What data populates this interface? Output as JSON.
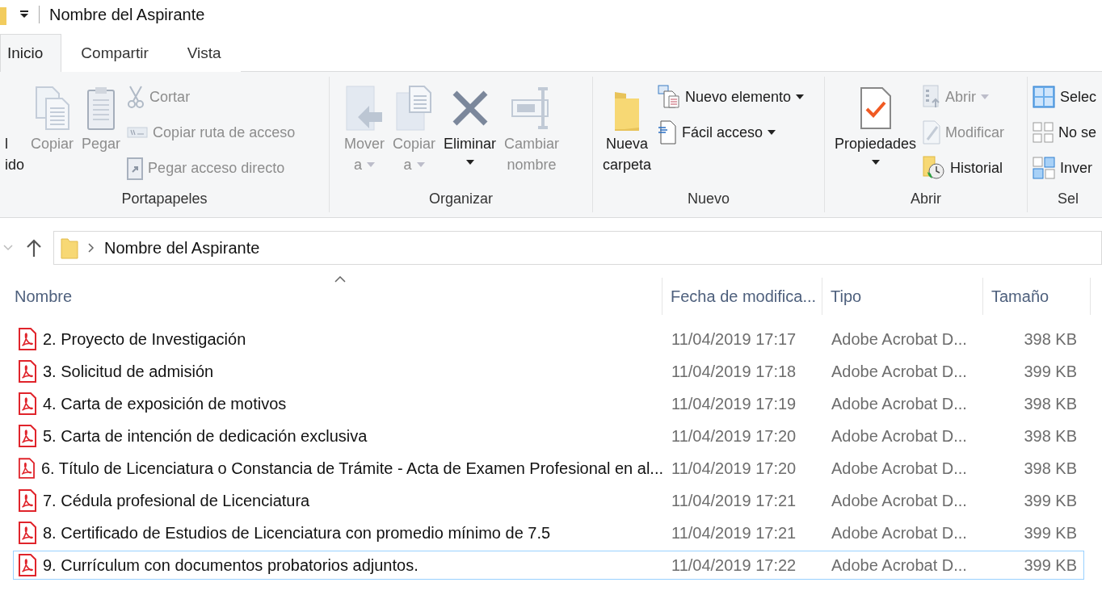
{
  "window": {
    "title": "Nombre del Aspirante"
  },
  "tabs": [
    {
      "label": "Inicio",
      "selected": true
    },
    {
      "label": "Compartir",
      "selected": false
    },
    {
      "label": "Vista",
      "selected": false
    }
  ],
  "ribbon": [
    {
      "label": "Portapapeles",
      "items": [
        {
          "kind": "partial",
          "lines": [
            "l",
            "ido"
          ]
        },
        {
          "kind": "large",
          "lines": [
            "Copiar"
          ],
          "disabled": true,
          "dropdown": false
        },
        {
          "kind": "large",
          "lines": [
            "Pegar"
          ],
          "disabled": true,
          "dropdown": false
        },
        {
          "kind": "small",
          "lines": [
            "Cortar"
          ],
          "disabled": true,
          "dropdown": false
        },
        {
          "kind": "small",
          "lines": [
            "Copiar ruta de acceso"
          ],
          "disabled": true,
          "dropdown": false
        },
        {
          "kind": "small",
          "lines": [
            "Pegar acceso directo"
          ],
          "disabled": true,
          "dropdown": false
        }
      ]
    },
    {
      "label": "Organizar",
      "items": [
        {
          "kind": "large",
          "lines": [
            "Mover",
            "a"
          ],
          "disabled": true,
          "dropdown": true
        },
        {
          "kind": "large",
          "lines": [
            "Copiar",
            "a"
          ],
          "disabled": true,
          "dropdown": true
        },
        {
          "kind": "large",
          "lines": [
            "Eliminar"
          ],
          "disabled": false,
          "dropdown": true
        },
        {
          "kind": "large",
          "lines": [
            "Cambiar",
            "nombre"
          ],
          "disabled": true,
          "dropdown": false
        }
      ]
    },
    {
      "label": "Nuevo",
      "items": [
        {
          "kind": "large",
          "lines": [
            "Nueva",
            "carpeta"
          ],
          "disabled": false,
          "dropdown": false
        },
        {
          "kind": "small",
          "lines": [
            "Nuevo elemento"
          ],
          "disabled": false,
          "dropdown": true
        },
        {
          "kind": "small",
          "lines": [
            "Fácil acceso"
          ],
          "disabled": false,
          "dropdown": true
        }
      ]
    },
    {
      "label": "Abrir",
      "items": [
        {
          "kind": "large",
          "lines": [
            "Propiedades"
          ],
          "disabled": false,
          "dropdown": true
        },
        {
          "kind": "small",
          "lines": [
            "Abrir"
          ],
          "disabled": true,
          "dropdown": true
        },
        {
          "kind": "small",
          "lines": [
            "Modificar"
          ],
          "disabled": true,
          "dropdown": false
        },
        {
          "kind": "small",
          "lines": [
            "Historial"
          ],
          "disabled": false,
          "dropdown": false
        }
      ]
    },
    {
      "label": "Sel",
      "items": [
        {
          "kind": "small",
          "lines": [
            "Selec"
          ],
          "disabled": false
        },
        {
          "kind": "small",
          "lines": [
            "No se"
          ],
          "disabled": false
        },
        {
          "kind": "small",
          "lines": [
            "Inver"
          ],
          "disabled": false
        }
      ]
    }
  ],
  "address": {
    "path": "Nombre del Aspirante"
  },
  "table": {
    "columns": [
      {
        "label": "Nombre",
        "sorted": true
      },
      {
        "label": "Fecha de modifica...",
        "sorted": false
      },
      {
        "label": "Tipo",
        "sorted": false
      },
      {
        "label": "Tamaño",
        "sorted": false
      }
    ],
    "rows": [
      {
        "name": "2. Proyecto de Investigación",
        "date": "11/04/2019 17:17",
        "type": "Adobe Acrobat D...",
        "size": "398 KB",
        "focused": false
      },
      {
        "name": "3. Solicitud de admisión",
        "date": "11/04/2019 17:18",
        "type": "Adobe Acrobat D...",
        "size": "399 KB",
        "focused": false
      },
      {
        "name": "4. Carta de exposición de motivos",
        "date": "11/04/2019 17:19",
        "type": "Adobe Acrobat D...",
        "size": "398 KB",
        "focused": false
      },
      {
        "name": "5. Carta de intención de dedicación exclusiva",
        "date": "11/04/2019 17:20",
        "type": "Adobe Acrobat D...",
        "size": "398 KB",
        "focused": false
      },
      {
        "name": "6. Título de Licenciatura o Constancia de Trámite - Acta de Examen Profesional en al...",
        "date": "11/04/2019 17:20",
        "type": "Adobe Acrobat D...",
        "size": "398 KB",
        "focused": false
      },
      {
        "name": "7. Cédula profesional de Licenciatura",
        "date": "11/04/2019 17:21",
        "type": "Adobe Acrobat D...",
        "size": "399 KB",
        "focused": false
      },
      {
        "name": "8. Certificado de Estudios de Licenciatura con promedio mínimo de 7.5",
        "date": "11/04/2019 17:21",
        "type": "Adobe Acrobat D...",
        "size": "399 KB",
        "focused": false
      },
      {
        "name": "9. Currículum con documentos probatorios adjuntos.",
        "date": "11/04/2019 17:22",
        "type": "Adobe Acrobat D...",
        "size": "399 KB",
        "focused": true
      }
    ]
  }
}
